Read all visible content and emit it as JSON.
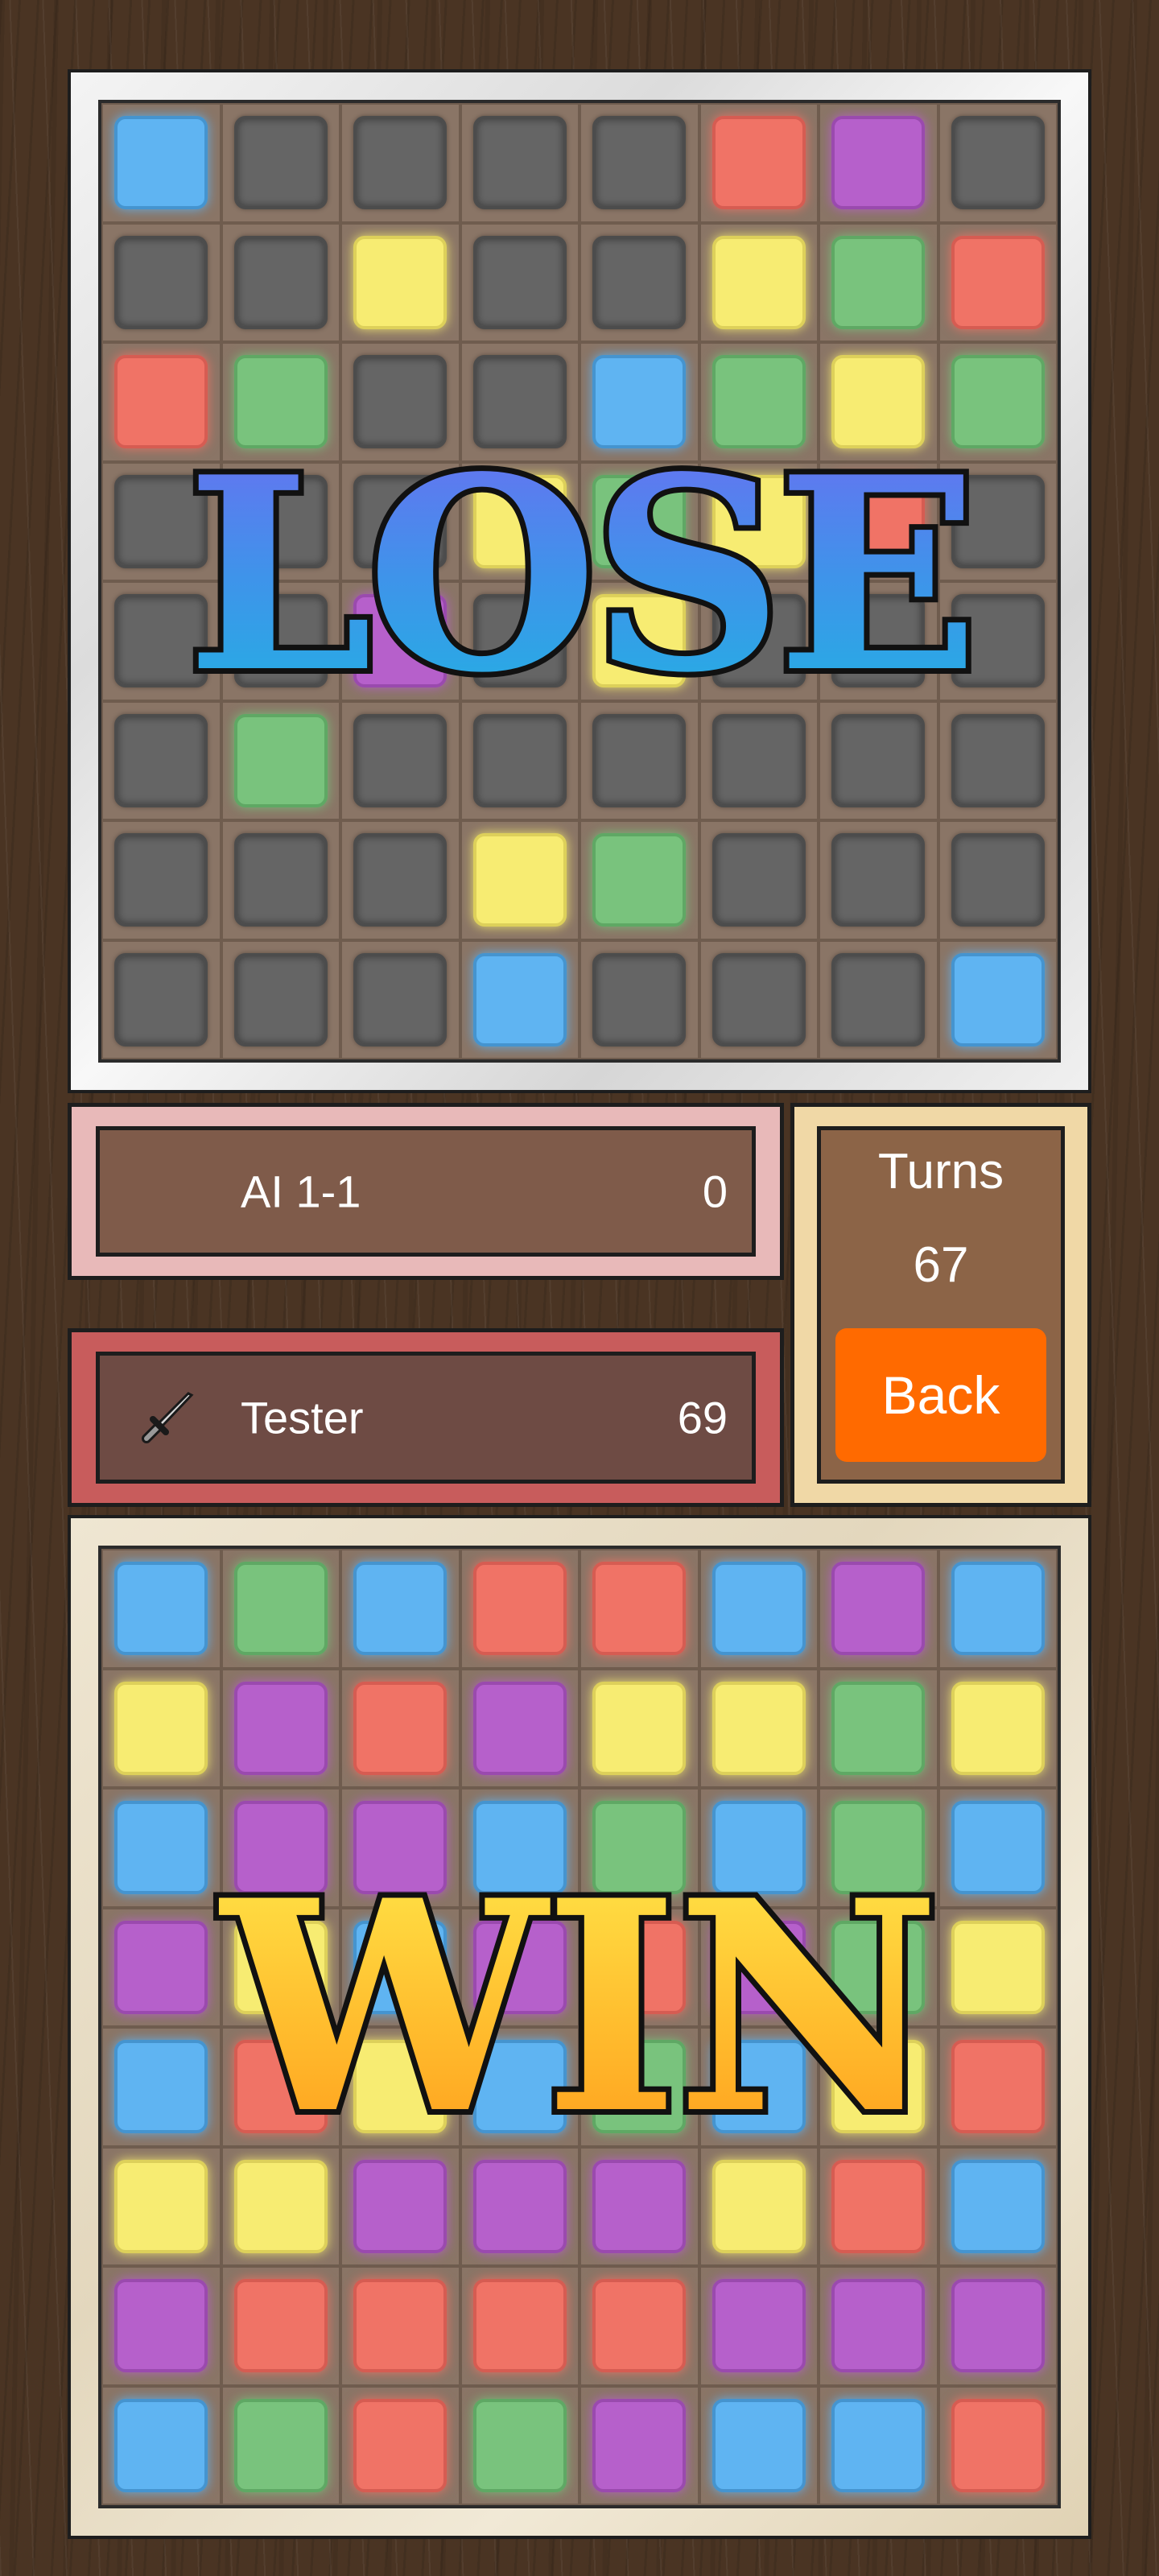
{
  "top_board": {
    "result_text": "LOSE",
    "rows": [
      [
        "blue",
        "gray",
        "gray",
        "gray",
        "gray",
        "red",
        "purple",
        "gray"
      ],
      [
        "gray",
        "gray",
        "yellow",
        "gray",
        "gray",
        "yellow",
        "green",
        "red"
      ],
      [
        "red",
        "green",
        "gray",
        "gray",
        "blue",
        "green",
        "yellow",
        "green"
      ],
      [
        "gray",
        "gray",
        "gray",
        "yellow",
        "green",
        "yellow",
        "red",
        "gray"
      ],
      [
        "gray",
        "gray",
        "purple",
        "gray",
        "yellow",
        "gray",
        "gray",
        "gray"
      ],
      [
        "gray",
        "green",
        "gray",
        "gray",
        "gray",
        "gray",
        "gray",
        "gray"
      ],
      [
        "gray",
        "gray",
        "gray",
        "yellow",
        "green",
        "gray",
        "gray",
        "gray"
      ],
      [
        "gray",
        "gray",
        "gray",
        "blue",
        "gray",
        "gray",
        "gray",
        "blue"
      ]
    ]
  },
  "opponent": {
    "name": "AI 1-1",
    "score": "0"
  },
  "player": {
    "name": "Tester",
    "score": "69",
    "icon": "sword-icon"
  },
  "turns": {
    "label": "Turns",
    "value": "67"
  },
  "back_button": {
    "label": "Back"
  },
  "bottom_board": {
    "result_text": "WIN",
    "rows": [
      [
        "blue",
        "green",
        "blue",
        "red",
        "red",
        "blue",
        "purple",
        "blue"
      ],
      [
        "yellow",
        "purple",
        "red",
        "purple",
        "yellow",
        "yellow",
        "green",
        "yellow"
      ],
      [
        "blue",
        "purple",
        "purple",
        "blue",
        "green",
        "blue",
        "green",
        "blue"
      ],
      [
        "purple",
        "yellow",
        "blue",
        "purple",
        "red",
        "purple",
        "green",
        "yellow"
      ],
      [
        "blue",
        "red",
        "yellow",
        "blue",
        "green",
        "blue",
        "yellow",
        "red"
      ],
      [
        "yellow",
        "yellow",
        "purple",
        "purple",
        "purple",
        "yellow",
        "red",
        "blue"
      ],
      [
        "purple",
        "red",
        "red",
        "red",
        "red",
        "purple",
        "purple",
        "purple"
      ],
      [
        "blue",
        "green",
        "red",
        "green",
        "purple",
        "blue",
        "blue",
        "red"
      ]
    ]
  },
  "colors": {
    "blue": "#5fb4f2",
    "red": "#f07366",
    "purple": "#b660cb",
    "yellow": "#f7ec72",
    "green": "#79c37d",
    "gray": "#656565",
    "back_button": "#ff6a00"
  }
}
